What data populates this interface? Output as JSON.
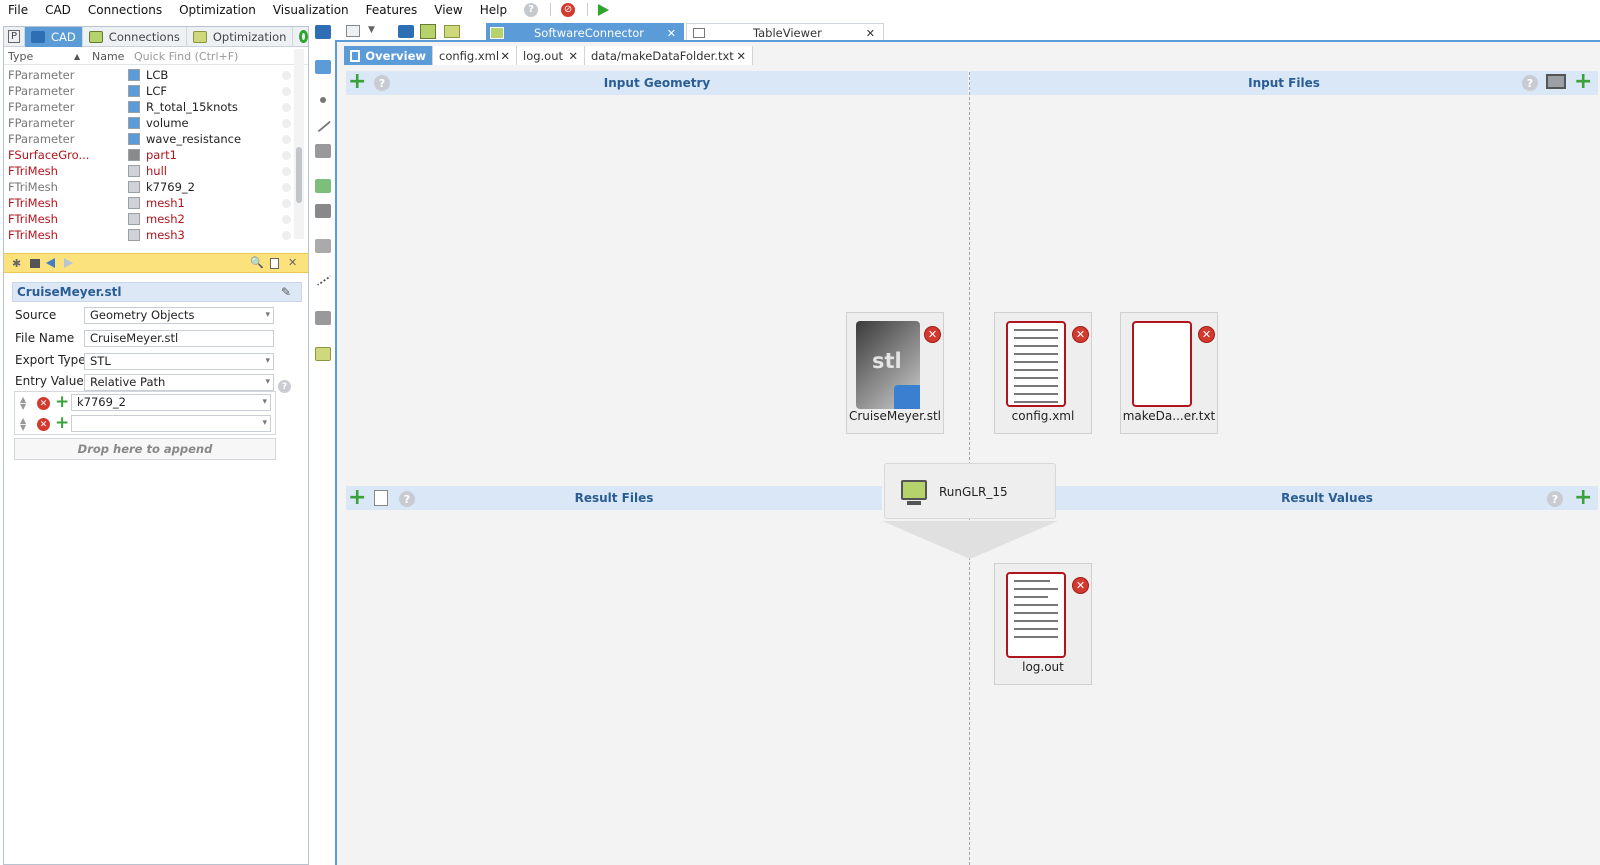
{
  "menubar": {
    "items": [
      "File",
      "CAD",
      "Connections",
      "Optimization",
      "Visualization",
      "Features",
      "View",
      "Help"
    ]
  },
  "left_tabs": {
    "p_label": "P",
    "items": [
      {
        "label": "CAD",
        "active": true
      },
      {
        "label": "Connections",
        "active": false
      },
      {
        "label": "Optimization",
        "active": false
      }
    ]
  },
  "tree": {
    "col_type": "Type",
    "col_name": "Name",
    "quick_find_placeholder": "Quick Find (Ctrl+F)",
    "rows": [
      {
        "type": "FParameter",
        "name": "LCB",
        "style": "grey",
        "icon": "parameter-icon"
      },
      {
        "type": "FParameter",
        "name": "LCF",
        "style": "grey",
        "icon": "parameter-icon"
      },
      {
        "type": "FParameter",
        "name": "R_total_15knots",
        "style": "grey",
        "icon": "parameter-icon"
      },
      {
        "type": "FParameter",
        "name": "volume",
        "style": "grey",
        "icon": "parameter-icon"
      },
      {
        "type": "FParameter",
        "name": "wave_resistance",
        "style": "grey",
        "icon": "parameter-icon"
      },
      {
        "type": "FSurfaceGro...",
        "name": "part1",
        "style": "red",
        "icon": "surface-group-icon"
      },
      {
        "type": "FTriMesh",
        "name": "hull",
        "style": "red",
        "icon": "mesh-icon"
      },
      {
        "type": "FTriMesh",
        "name": "k7769_2",
        "style": "grey",
        "icon": "mesh-icon"
      },
      {
        "type": "FTriMesh",
        "name": "mesh1",
        "style": "red",
        "icon": "mesh-icon"
      },
      {
        "type": "FTriMesh",
        "name": "mesh2",
        "style": "red",
        "icon": "mesh-icon"
      },
      {
        "type": "FTriMesh",
        "name": "mesh3",
        "style": "red",
        "icon": "mesh-icon"
      }
    ]
  },
  "props": {
    "title": "CruiseMeyer.stl",
    "source_label": "Source",
    "source_value": "Geometry Objects",
    "file_name_label": "File Name",
    "file_name_value": "CruiseMeyer.stl",
    "export_type_label": "Export Type",
    "export_type_value": "STL",
    "entry_value_label": "Entry Value",
    "entry_value_value": "Relative Path",
    "list_items": [
      "k7769_2",
      ""
    ],
    "drop_hint": "Drop here to append"
  },
  "top_tabs": {
    "software_connector": "SoftwareConnector",
    "table_viewer": "TableViewer"
  },
  "sub_tabs": [
    "Overview",
    "config.xml",
    "log.out",
    "data/makeDataFolder.txt"
  ],
  "sections": {
    "input_geometry": "Input Geometry",
    "input_files": "Input Files",
    "result_files": "Result Files",
    "result_values": "Result Values"
  },
  "cards": {
    "stl": {
      "label": "CruiseMeyer.stl",
      "badge": "stl"
    },
    "config": {
      "label": "config.xml"
    },
    "makedata": {
      "label": "makeDa...er.txt"
    },
    "log": {
      "label": "log.out"
    }
  },
  "connector": {
    "name": "RunGLR_15"
  },
  "colors": {
    "accent": "#5b9bd8",
    "section_bg": "#d9e7f6",
    "section_text": "#2a5d94",
    "error_red": "#d23a2f",
    "add_green": "#3aa23a",
    "yellow_bar": "#fbe27c"
  }
}
